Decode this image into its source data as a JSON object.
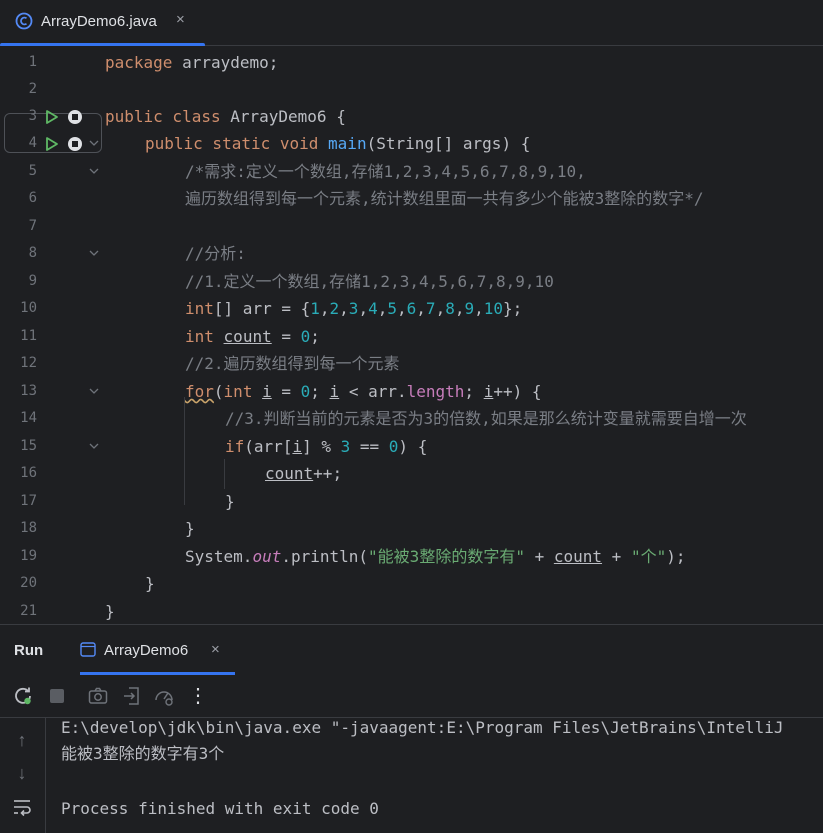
{
  "editor_tab": {
    "label": "ArrayDemo6.java",
    "close": "×"
  },
  "editor": {
    "line_numbers": [
      "1",
      "2",
      "3",
      "4",
      "5",
      "6",
      "7",
      "8",
      "9",
      "10",
      "11",
      "12",
      "13",
      "14",
      "15",
      "16",
      "17",
      "18",
      "19",
      "20",
      "21"
    ],
    "tokens": {
      "package": "package",
      "arraydemo": " arraydemo;",
      "public1": "public",
      "class": " class",
      "classname": " ArrayDemo6 {",
      "public2": "public",
      "static": " static",
      "void": " void",
      "main": " main",
      "args": "(String[] args) {",
      "c5": "/*需求:定义一个数组,存储1,2,3,4,5,6,7,8,9,10,",
      "c6": "遍历数组得到每一个元素,统计数组里面一共有多少个能被3整除的数字*/",
      "c8": "//分析:",
      "c9": "//1.定义一个数组,存储1,2,3,4,5,6,7,8,9,10",
      "int10": "int",
      "arr10a": "[] arr = {",
      "n1": "1",
      "n2": "2",
      "n3": "3",
      "n4": "4",
      "n5": "5",
      "n6": "6",
      "n7": "7",
      "n8": "8",
      "n9": "9",
      "n10": "10",
      "comma": ",",
      "arr10b": "};",
      "int11": "int",
      "count11": "count",
      "eq11": " = ",
      "zero11": "0",
      "semi11": ";",
      "c12": "//2.遍历数组得到每一个元素",
      "for": "for",
      "p13a": "(",
      "int13": "int",
      "i13a": "i",
      "p13b": " = ",
      "zero13": "0",
      "p13c": "; ",
      "i13b": "i",
      "p13d": " < arr.",
      "length": "length",
      "p13e": "; ",
      "i13c": "i",
      "p13f": "++) {",
      "c14": "//3.判断当前的元素是否为3的倍数,如果是那么统计变量就需要自增一次",
      "if": "if",
      "p15a": "(arr[",
      "i15": "i",
      "p15b": "] % ",
      "three15": "3",
      "p15c": " == ",
      "zero15": "0",
      "p15d": ") {",
      "count16": "count",
      "p16": "++;",
      "brace17": "}",
      "brace18": "}",
      "sys19": "System.",
      "out": "out",
      "p19a": ".println(",
      "s19a": "\"能被3整除的数字有\"",
      "p19b": " + ",
      "count19": "count",
      "p19c": " + ",
      "s19b": "\"个\"",
      "p19d": ");",
      "brace20": "}",
      "brace21": "}"
    }
  },
  "run_panel": {
    "title": "Run",
    "tab_label": "ArrayDemo6",
    "tab_close": "×",
    "more": "⋮",
    "console_lines": [
      "E:\\develop\\jdk\\bin\\java.exe \"-javaagent:E:\\Program Files\\JetBrains\\IntelliJ",
      "能被3整除的数字有3个",
      "",
      "Process finished with exit code 0"
    ],
    "side_icons": {
      "up": "↑",
      "down": "↓"
    }
  },
  "colors": {
    "accent": "#3574f0",
    "run_green": "#5fb865",
    "keyword": "#cf8e6d",
    "number": "#2aacb8",
    "comment": "#7a7e85",
    "string": "#6aab73",
    "function": "#56a8f5"
  }
}
